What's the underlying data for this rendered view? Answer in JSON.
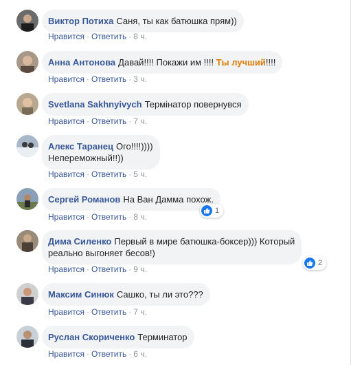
{
  "labels": {
    "like": "Нравится",
    "reply": "Ответить",
    "dot": "·"
  },
  "colors": {
    "author": "#385898",
    "highlight": "#e07a00",
    "bubble": "#f2f3f5",
    "like": "#1877f2"
  },
  "comments": [
    {
      "author": "Виктор Потиха",
      "text": "Саня, ты как батюшка прям))",
      "time": "8 ч."
    },
    {
      "author": "Анна Антонова",
      "text_before": "Давай!!!! Покажи им !!!!",
      "highlight": "Ты лучший",
      "text_after": "!!!!",
      "time": "3 ч."
    },
    {
      "author": "Svetlana Sakhnyivych",
      "text": "Термінатор повернувся",
      "time": "7 ч."
    },
    {
      "author": "Алекс Таранец",
      "text": "Ого!!!!))))",
      "text_line2": "Непереможный!!))",
      "time": "5 ч."
    },
    {
      "author": "Сергей Романов",
      "text": "На Ван Дамма похож.",
      "time": "8 ч.",
      "reactions": "1"
    },
    {
      "author": "Дима Силенко",
      "text": "Первый в мире батюшка-боксер))) Который",
      "text_line2": "реально выгоняет бесов!)",
      "time": "9 ч.",
      "reactions": "2"
    },
    {
      "author": "Максим Синюк",
      "text": "Сашко, ты ли это???",
      "time": "7 ч."
    },
    {
      "author": "Руслан Скориченко",
      "text": "Терминатор",
      "time": "6 ч."
    }
  ]
}
